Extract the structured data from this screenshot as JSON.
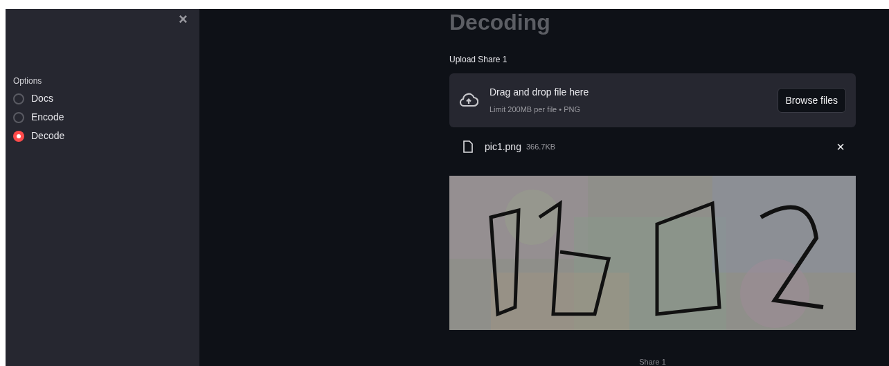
{
  "sidebar": {
    "close_label": "×",
    "options_label": "Options",
    "options": [
      {
        "label": "Docs",
        "selected": false
      },
      {
        "label": "Encode",
        "selected": false
      },
      {
        "label": "Decode",
        "selected": true
      }
    ]
  },
  "main": {
    "title": "Decoding",
    "upload_label": "Upload Share 1",
    "dropzone": {
      "heading": "Drag and drop file here",
      "hint": "Limit 200MB per file • PNG",
      "button": "Browse files"
    },
    "file": {
      "name": "pic1.png",
      "size": "366.7KB",
      "remove_label": "×"
    },
    "image": {
      "kind": "picture",
      "caption": "Share 1"
    }
  }
}
